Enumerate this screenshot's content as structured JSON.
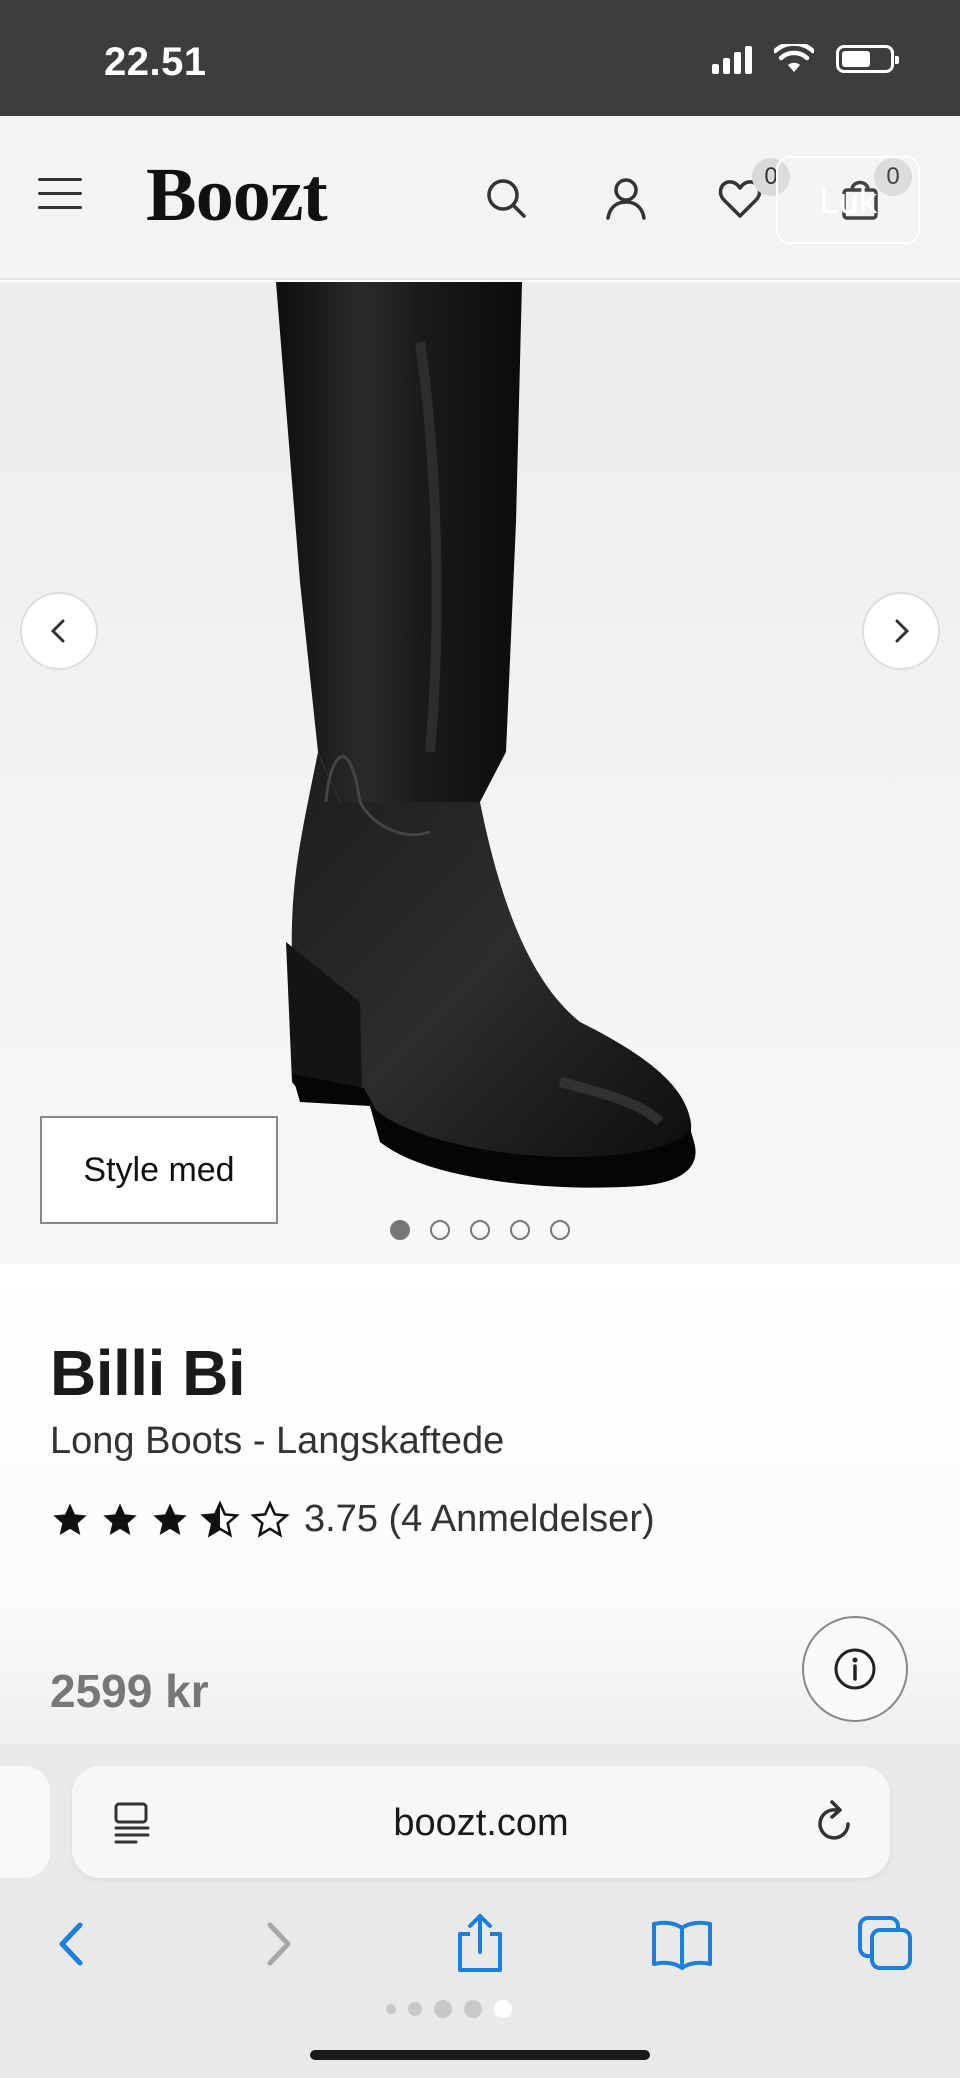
{
  "status_bar": {
    "time": "22.51",
    "battery_level": 0.6
  },
  "header": {
    "logo": "Boozt",
    "wishlist_count": "0",
    "cart_count": "0",
    "close_label": "Luk"
  },
  "gallery": {
    "style_button_label": "Style med",
    "image_count": 5,
    "active_image": 1
  },
  "product": {
    "brand": "Billi Bi",
    "name": "Long Boots - Langskaftede",
    "rating_value": 3.75,
    "rating_text": "3.75 (4 Anmeldelser)",
    "price": "2599 kr"
  },
  "browser": {
    "url": "boozt.com",
    "tab_page_count": 5,
    "tab_page_active": 5
  },
  "colors": {
    "status_bar_bg": "#3d3d3d",
    "header_bg": "#f3f3f3",
    "price_text": "#777777",
    "safari_blue": "#1a7fe0"
  }
}
